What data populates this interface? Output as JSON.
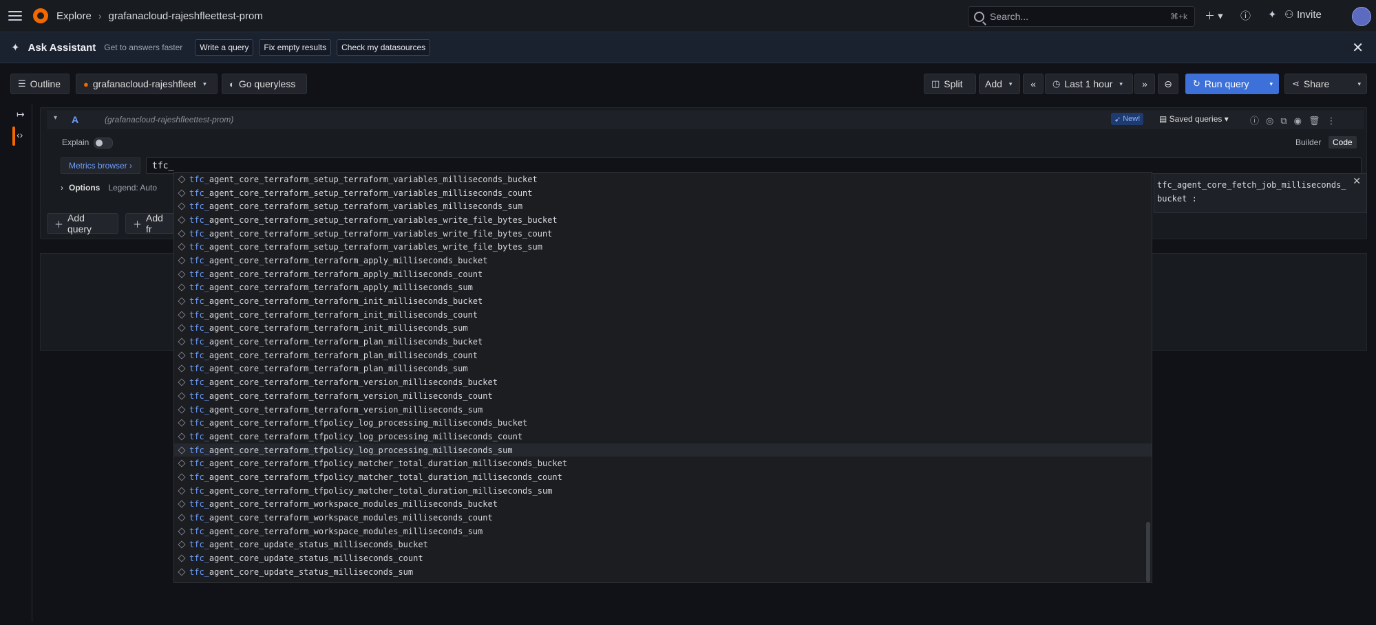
{
  "topbar": {
    "app": "Explore",
    "datasource": "grafanacloud-rajeshfleettest-prom",
    "search_placeholder": "Search...",
    "search_shortcut": "⌘+k",
    "invite": "Invite"
  },
  "assistant": {
    "title": "Ask Assistant",
    "subtitle": "Get to answers faster",
    "chips": [
      "Write a query",
      "Fix empty results",
      "Check my datasources"
    ]
  },
  "toolbar": {
    "outline": "Outline",
    "datasource_short": "grafanacloud-rajeshfleet",
    "queryless": "Go queryless",
    "split": "Split",
    "add": "Add",
    "time_range": "Last 1 hour",
    "run_query": "Run query",
    "share": "Share"
  },
  "query": {
    "letter": "A",
    "datasource": "(grafanacloud-rajeshfleettest-prom)",
    "new_badge": "New!",
    "saved_queries": "Saved queries",
    "explain": "Explain",
    "mode_builder": "Builder",
    "mode_code": "Code",
    "metrics_browser": "Metrics browser ›",
    "input_value": "tfc_",
    "options": "Options",
    "legend": "Legend: Auto",
    "add_query": "Add query",
    "add_from": "Add fr"
  },
  "info_card": {
    "text": "tfc_agent_core_fetch_job_milliseconds_bucket :"
  },
  "suggestions": {
    "prefix": "tfc_",
    "items": [
      "agent_core_terraform_setup_terraform_variables_milliseconds_bucket",
      "agent_core_terraform_setup_terraform_variables_milliseconds_count",
      "agent_core_terraform_setup_terraform_variables_milliseconds_sum",
      "agent_core_terraform_setup_terraform_variables_write_file_bytes_bucket",
      "agent_core_terraform_setup_terraform_variables_write_file_bytes_count",
      "agent_core_terraform_setup_terraform_variables_write_file_bytes_sum",
      "agent_core_terraform_terraform_apply_milliseconds_bucket",
      "agent_core_terraform_terraform_apply_milliseconds_count",
      "agent_core_terraform_terraform_apply_milliseconds_sum",
      "agent_core_terraform_terraform_init_milliseconds_bucket",
      "agent_core_terraform_terraform_init_milliseconds_count",
      "agent_core_terraform_terraform_init_milliseconds_sum",
      "agent_core_terraform_terraform_plan_milliseconds_bucket",
      "agent_core_terraform_terraform_plan_milliseconds_count",
      "agent_core_terraform_terraform_plan_milliseconds_sum",
      "agent_core_terraform_terraform_version_milliseconds_bucket",
      "agent_core_terraform_terraform_version_milliseconds_count",
      "agent_core_terraform_terraform_version_milliseconds_sum",
      "agent_core_terraform_tfpolicy_log_processing_milliseconds_bucket",
      "agent_core_terraform_tfpolicy_log_processing_milliseconds_count",
      "agent_core_terraform_tfpolicy_log_processing_milliseconds_sum",
      "agent_core_terraform_tfpolicy_matcher_total_duration_milliseconds_bucket",
      "agent_core_terraform_tfpolicy_matcher_total_duration_milliseconds_count",
      "agent_core_terraform_tfpolicy_matcher_total_duration_milliseconds_sum",
      "agent_core_terraform_workspace_modules_milliseconds_bucket",
      "agent_core_terraform_workspace_modules_milliseconds_count",
      "agent_core_terraform_workspace_modules_milliseconds_sum",
      "agent_core_update_status_milliseconds_bucket",
      "agent_core_update_status_milliseconds_count",
      "agent_core_update_status_milliseconds_sum"
    ],
    "highlighted_index": 20
  },
  "colors": {
    "accent": "#3d71d9",
    "brand": "#f46800",
    "link": "#6e9fff"
  }
}
